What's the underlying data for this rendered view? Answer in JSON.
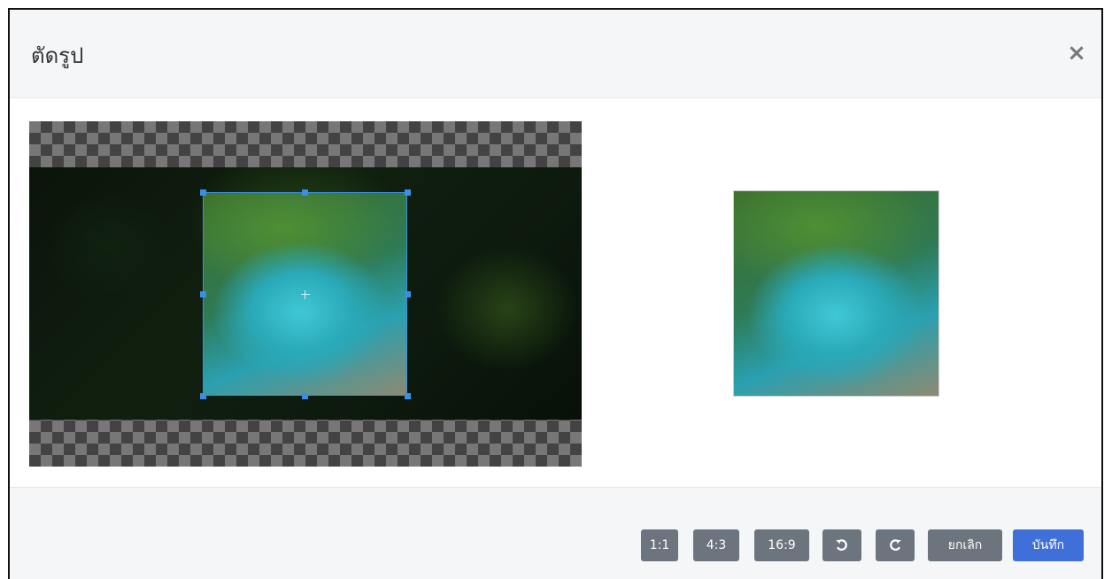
{
  "modal": {
    "title": "ตัดรูป",
    "close_label": "×"
  },
  "toolbar": {
    "ratio_1_1": "1:1",
    "ratio_4_3": "4:3",
    "ratio_16_9": "16:9",
    "rotate_left_icon": "rotate-left-icon",
    "rotate_right_icon": "rotate-right-icon",
    "cancel_label": "ยกเลิก",
    "save_label": "บันทึก"
  },
  "colors": {
    "accent": "#3a8ee6",
    "primary": "#3f6fd8",
    "secondary": "#6c757d"
  }
}
